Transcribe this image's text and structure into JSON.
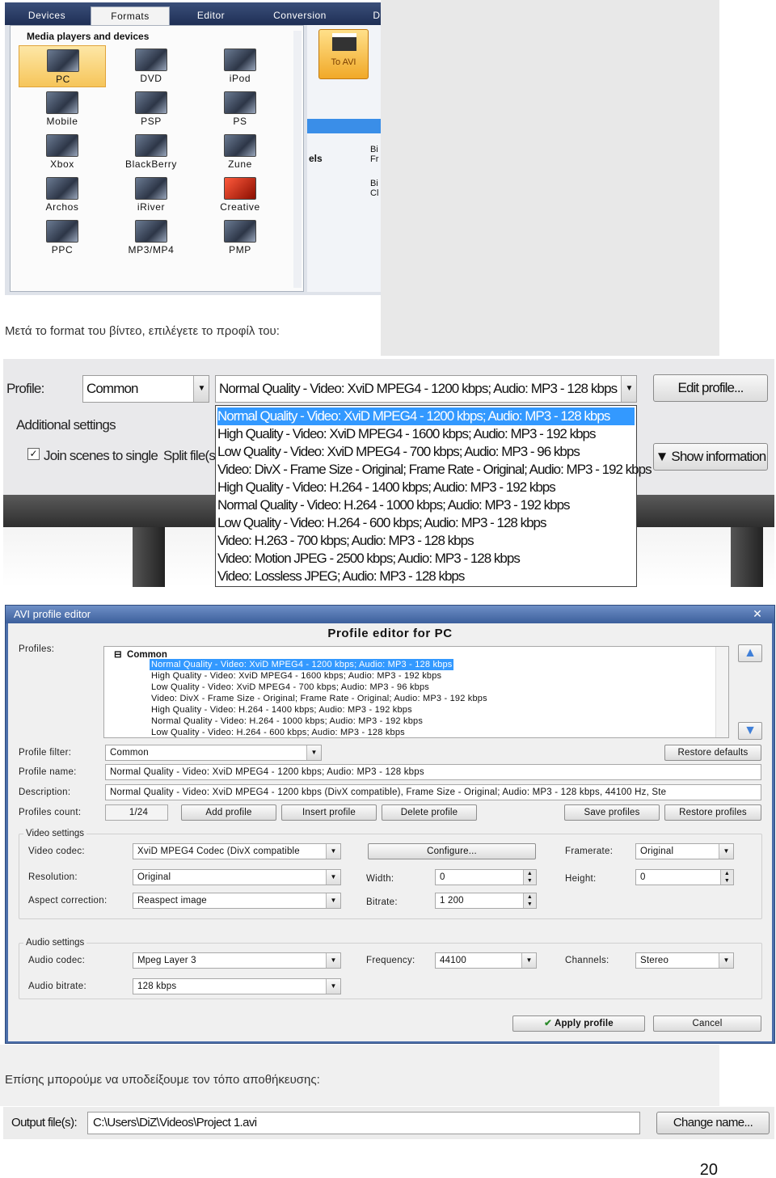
{
  "shot1": {
    "tabs": [
      "Devices",
      "Formats",
      "Editor",
      "Conversion",
      "D"
    ],
    "panel_title": "Media players and devices",
    "devices": [
      "PC",
      "DVD",
      "iPod",
      "Mobile",
      "PSP",
      "PS",
      "Xbox",
      "BlackBerry",
      "Zune",
      "Archos",
      "iRiver",
      "Creative",
      "PPC",
      "MP3/MP4",
      "PMP"
    ],
    "to_avi": "To AVI",
    "fragments": [
      "els",
      "Bi",
      "Fr",
      "Bi",
      "Cl"
    ]
  },
  "caption1": "Μετά το format του βίντεο, επιλέγετε το προφίλ του:",
  "shot2": {
    "profile_label": "Profile:",
    "profile_value": "Common",
    "quality_value": "Normal Quality - Video: XviD MPEG4 - 1200 kbps; Audio: MP3 - 128 kbps",
    "edit_profile": "Edit profile...",
    "additional_settings": "Additional settings",
    "join_scenes": "Join scenes to single",
    "split_files": "Split file(s)",
    "show_information": "Show information",
    "options": [
      "Normal Quality - Video: XviD MPEG4 - 1200 kbps; Audio: MP3 - 128 kbps",
      "High Quality - Video: XviD MPEG4 - 1600 kbps; Audio: MP3 - 192 kbps",
      "Low Quality - Video: XviD MPEG4 - 700 kbps; Audio: MP3 - 96 kbps",
      "Video: DivX - Frame Size - Original; Frame Rate - Original; Audio: MP3 - 192 kbps",
      "High Quality - Video: H.264 - 1400 kbps; Audio: MP3 - 192 kbps",
      "Normal Quality - Video: H.264 - 1000 kbps; Audio: MP3 - 192 kbps",
      "Low Quality - Video: H.264 - 600 kbps; Audio: MP3 - 128 kbps",
      "Video: H.263 - 700 kbps; Audio: MP3 - 128 kbps",
      "Video: Motion JPEG - 2500 kbps; Audio: MP3 - 128 kbps",
      "Video: Lossless JPEG; Audio: MP3 - 128 kbps"
    ]
  },
  "shot3": {
    "window_title": "AVI profile editor",
    "close": "✕",
    "heading": "Profile editor for PC",
    "profiles_label": "Profiles:",
    "group_name": "Common",
    "profiles": [
      "Normal Quality - Video: XviD MPEG4 - 1200 kbps; Audio: MP3 - 128 kbps",
      "High Quality - Video: XviD MPEG4 - 1600 kbps; Audio: MP3 - 192 kbps",
      "Low Quality - Video: XviD MPEG4 - 700 kbps; Audio: MP3 - 96 kbps",
      "Video: DivX - Frame Size - Original; Frame Rate - Original; Audio: MP3 - 192 kbps",
      "High Quality - Video: H.264 - 1400 kbps; Audio: MP3 - 192 kbps",
      "Normal Quality - Video: H.264 - 1000 kbps; Audio: MP3 - 192 kbps",
      "Low Quality - Video: H.264 - 600 kbps; Audio: MP3 - 128 kbps"
    ],
    "profile_filter_label": "Profile filter:",
    "profile_filter": "Common",
    "restore_defaults": "Restore defaults",
    "profile_name_label": "Profile name:",
    "profile_name": "Normal Quality - Video: XviD MPEG4 - 1200 kbps; Audio: MP3 - 128 kbps",
    "description_label": "Description:",
    "description": "Normal Quality - Video: XviD MPEG4 - 1200 kbps (DivX compatible), Frame Size - Original; Audio: MP3 - 128 kbps, 44100 Hz, Ste",
    "profiles_count_label": "Profiles count:",
    "profiles_count": "1/24",
    "add_profile": "Add profile",
    "insert_profile": "Insert profile",
    "delete_profile": "Delete profile",
    "save_profiles": "Save profiles",
    "restore_profiles": "Restore profiles",
    "video_settings": "Video settings",
    "video_codec_label": "Video codec:",
    "video_codec": "XviD MPEG4 Codec (DivX compatible",
    "configure": "Configure...",
    "framerate_label": "Framerate:",
    "framerate": "Original",
    "resolution_label": "Resolution:",
    "resolution": "Original",
    "width_label": "Width:",
    "width": "0",
    "height_label": "Height:",
    "height": "0",
    "aspect_label": "Aspect correction:",
    "aspect": "Reaspect image",
    "bitrate_label": "Bitrate:",
    "bitrate": "1 200",
    "audio_settings": "Audio settings",
    "audio_codec_label": "Audio codec:",
    "audio_codec": "Mpeg Layer 3",
    "frequency_label": "Frequency:",
    "frequency": "44100",
    "channels_label": "Channels:",
    "channels": "Stereo",
    "audio_bitrate_label": "Audio bitrate:",
    "audio_bitrate": "128 kbps",
    "apply_profile": "Apply profile",
    "cancel": "Cancel"
  },
  "caption2": "Επίσης μπορούμε να υποδείξουμε τον τόπο αποθήκευσης:",
  "shot4": {
    "output_label": "Output file(s):",
    "path": "C:\\Users\\DiZ\\Videos\\Project 1.avi",
    "change_name": "Change name..."
  },
  "page_number": "20"
}
